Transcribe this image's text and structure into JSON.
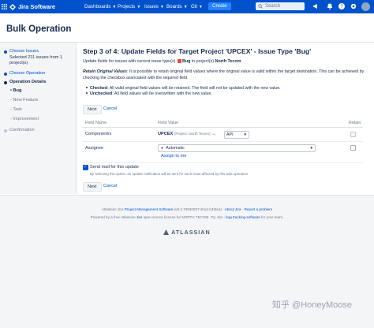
{
  "topnav": {
    "app_name": "Jira Software",
    "menu": [
      "Dashboards",
      "Projects",
      "Issues",
      "Boards",
      "Git"
    ],
    "create_label": "Create",
    "search_placeholder": "Search"
  },
  "page": {
    "title": "Bulk Operation"
  },
  "sidebar": {
    "steps": [
      {
        "label": "Choose Issues",
        "detail": "Selected 211 issues from 1 project(s)",
        "state": "done"
      },
      {
        "label": "Choose Operation",
        "state": "done"
      },
      {
        "label": "Operation Details",
        "state": "current"
      },
      {
        "label": "Confirmation",
        "state": "todo"
      }
    ],
    "substeps": [
      {
        "label": "Bug",
        "active": true
      },
      {
        "label": "New Feature",
        "active": false
      },
      {
        "label": "Task",
        "active": false
      },
      {
        "label": "Improvement",
        "active": false
      }
    ]
  },
  "main": {
    "heading": "Step 3 of 4: Update Fields for Target Project 'UPCEX' - Issue Type 'Bug'",
    "desc_prefix": "Update fields for issues with current issue type(s)",
    "desc_type": "Bug",
    "desc_mid": "in project(s)",
    "desc_project": "North Tecom",
    "retain_title": "Retain Original Values",
    "retain_text": ": It is possible to retain original field values where the original value is valid within the target destination. This can be achieved by checking the checkbox associated with the required field",
    "checked_label": "Checked",
    "checked_text": ": All valid original field values will be retained. The field will not be updated with the new value.",
    "unchecked_label": "Unchecked",
    "unchecked_text": ": All field values will be overwritten with the new value.",
    "next_label": "Next",
    "cancel_label": "Cancel",
    "table": {
      "col_field": "Field Name",
      "col_value": "Field Value",
      "col_retain": "Retain",
      "rows": [
        {
          "field": "Component/s",
          "value_prefix": "UPCEX",
          "value_source": "(Project: North Tecom)",
          "value_target": "API"
        },
        {
          "field": "Assignee",
          "value": "Automatic",
          "assign_link": "Assign to me"
        }
      ]
    },
    "send_mail_label": "Send mail for this update",
    "send_mail_note": "By selecting this option, an update notification will be sent for each issue affected by this bulk operation.",
    "next_label_2": "Next",
    "cancel_label_2": "Cancel"
  },
  "footer": {
    "line1_prefix": "Atlassian Jira",
    "line1_link": "Project Management Software",
    "line1_version": "(v9.4.7#940007-sha1:b4f4ea)",
    "line1_about": "About Jira",
    "line1_report": "Report a problem",
    "line2_prefix": "Powered by a free Atlassian",
    "line2_jira": "Jira",
    "line2_mid": "open source license for NORTH TECOM. Try Jira -",
    "line2_link": "bug tracking software",
    "line2_suffix": "for your team.",
    "brand": "ATLASSIAN"
  },
  "watermark": "知乎 @HoneyMoose",
  "colors": {
    "nav": "#0052cc",
    "create": "#2684ff",
    "link": "#0052cc",
    "bug": "#e5493a"
  }
}
